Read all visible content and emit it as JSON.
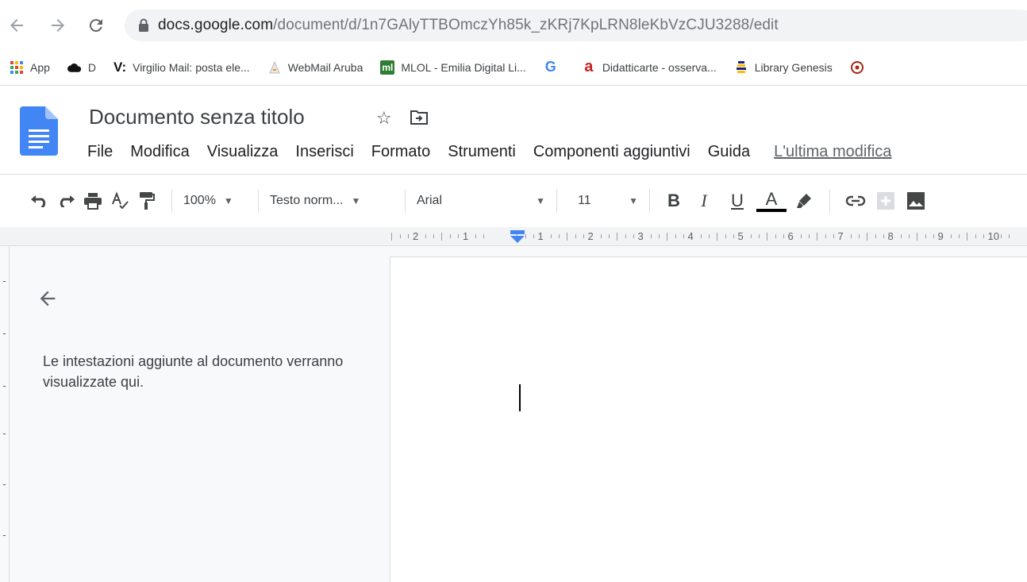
{
  "browser": {
    "url_host": "docs.google.com",
    "url_path": "/document/d/1n7GAlyTTBOmczYh85k_zKRj7KpLRN8leKbVzCJU3288/edit"
  },
  "bookmarks": [
    {
      "label": "App",
      "icon": "apps-grid-icon"
    },
    {
      "label": "D",
      "icon": "cloud-icon"
    },
    {
      "label": "Virgilio Mail: posta ele...",
      "icon": "virgilio-icon",
      "icon_text": "V:"
    },
    {
      "label": "WebMail Aruba",
      "icon": "aruba-icon"
    },
    {
      "label": "MLOL - Emilia Digital Li...",
      "icon": "mlol-icon",
      "icon_text": "ml"
    },
    {
      "label": "",
      "icon": "google-icon",
      "icon_text": "G"
    },
    {
      "label": "Didatticarte - osserva...",
      "icon": "didatticarte-icon",
      "icon_text": "a"
    },
    {
      "label": "Library Genesis",
      "icon": "library-genesis-icon"
    }
  ],
  "document": {
    "title": "Documento senza titolo"
  },
  "menu": {
    "items": [
      "File",
      "Modifica",
      "Visualizza",
      "Inserisci",
      "Formato",
      "Strumenti",
      "Componenti aggiuntivi",
      "Guida"
    ],
    "last_edit": "L'ultima modifica"
  },
  "toolbar": {
    "zoom": "100%",
    "style": "Testo norm...",
    "font": "Arial",
    "size": "11",
    "bold": "B",
    "italic": "I",
    "underline": "U",
    "text_color": "A"
  },
  "ruler": {
    "labels": [
      "2",
      "1",
      "1",
      "2",
      "3",
      "4",
      "5",
      "6",
      "7",
      "8",
      "9",
      "10"
    ]
  },
  "outline": {
    "empty_message": "Le intestazioni aggiunte al documento verranno visualizzate qui."
  },
  "colors": {
    "docs_blue": "#4285f4",
    "ruler_indent": "#4285f4"
  }
}
